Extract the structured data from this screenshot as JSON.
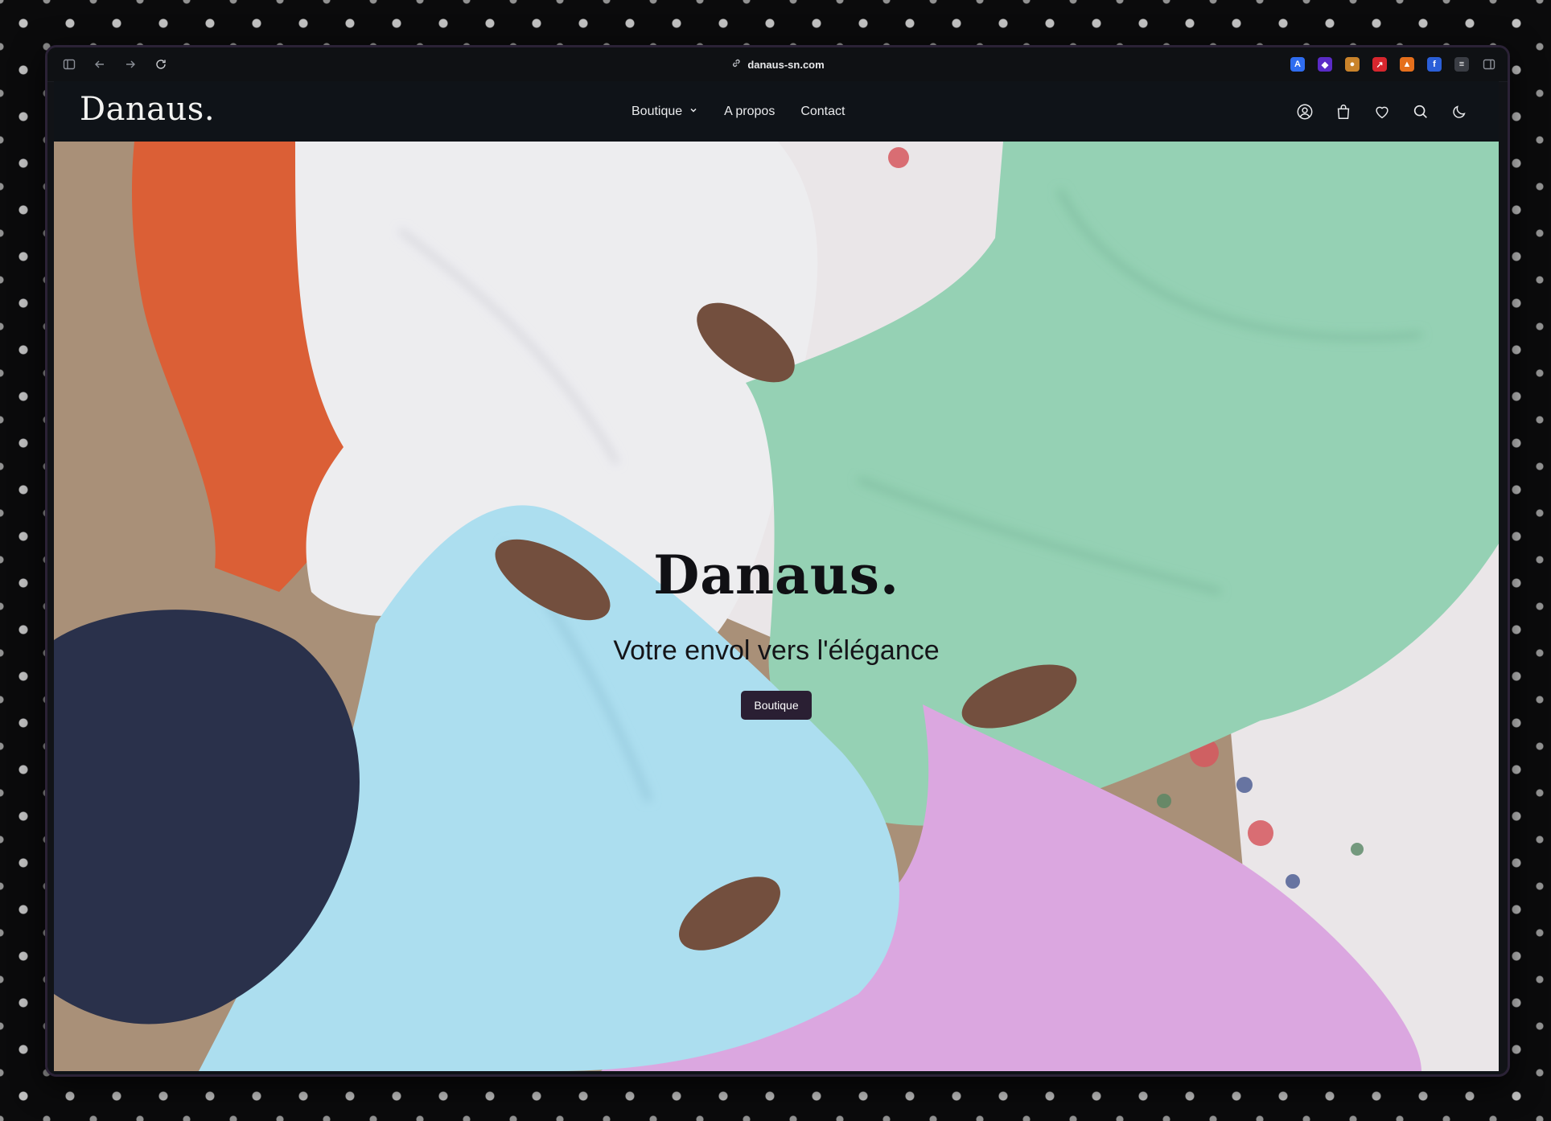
{
  "browser": {
    "url": "danaus-sn.com",
    "icons": [
      "sidebar-icon",
      "back-icon",
      "forward-icon",
      "reload-icon",
      "link-icon"
    ],
    "extensions": [
      {
        "name": "ext-a",
        "color": "#2f6df0",
        "glyph": "A"
      },
      {
        "name": "ext-b",
        "color": "#5a2bc7",
        "glyph": "◆"
      },
      {
        "name": "ext-c",
        "color": "#c9832b",
        "glyph": "●"
      },
      {
        "name": "ext-d",
        "color": "#d7262e",
        "glyph": "↗"
      },
      {
        "name": "ext-e",
        "color": "#e56f1c",
        "glyph": "▲"
      },
      {
        "name": "ext-f",
        "color": "#2b5fd8",
        "glyph": "f"
      },
      {
        "name": "ext-g",
        "color": "#3a3d44",
        "glyph": "≡"
      }
    ]
  },
  "nav": {
    "logo": "Danaus.",
    "menu": [
      {
        "label": "Boutique",
        "has_dropdown": true
      },
      {
        "label": "A propos",
        "has_dropdown": false
      },
      {
        "label": "Contact",
        "has_dropdown": false
      }
    ],
    "icons": [
      "account-icon",
      "bag-icon",
      "heart-icon",
      "search-icon",
      "moon-icon"
    ]
  },
  "hero": {
    "title": "Danaus.",
    "subtitle": "Votre envol vers l'élégance",
    "button_label": "Boutique"
  },
  "colors": {
    "background": "#0f1318",
    "button": "#2a1f33",
    "orange": "#d9562a",
    "white_fabric": "#ececef",
    "mint": "#8fcfb0",
    "sky": "#a7dcee",
    "lilac": "#d9a2df",
    "navy": "#1d2540"
  }
}
